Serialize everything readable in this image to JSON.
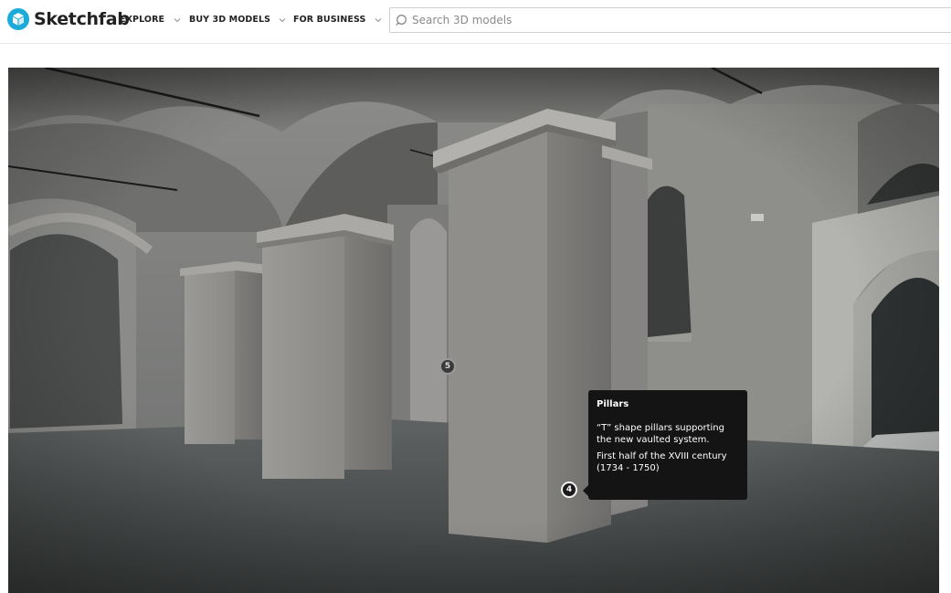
{
  "header": {
    "logo_text": "Sketchfab",
    "logo_color": "#1caad9",
    "nav": [
      {
        "label": "EXPLORE",
        "icon": "chevron-down-icon"
      },
      {
        "label": "BUY 3D MODELS",
        "icon": "chevron-down-icon"
      },
      {
        "label": "FOR BUSINESS",
        "icon": "chevron-down-icon"
      }
    ],
    "search": {
      "placeholder": "Search 3D models",
      "value": "",
      "icon": "search-icon"
    }
  },
  "viewer": {
    "hotspots": [
      {
        "number": "5"
      },
      {
        "number": "4"
      }
    ],
    "annotation": {
      "title": "Pillars",
      "text_1": "“T” shape pillars supporting the new vaulted system.",
      "text_2": "First half of the XVIII century (1734 - 1750)"
    }
  }
}
